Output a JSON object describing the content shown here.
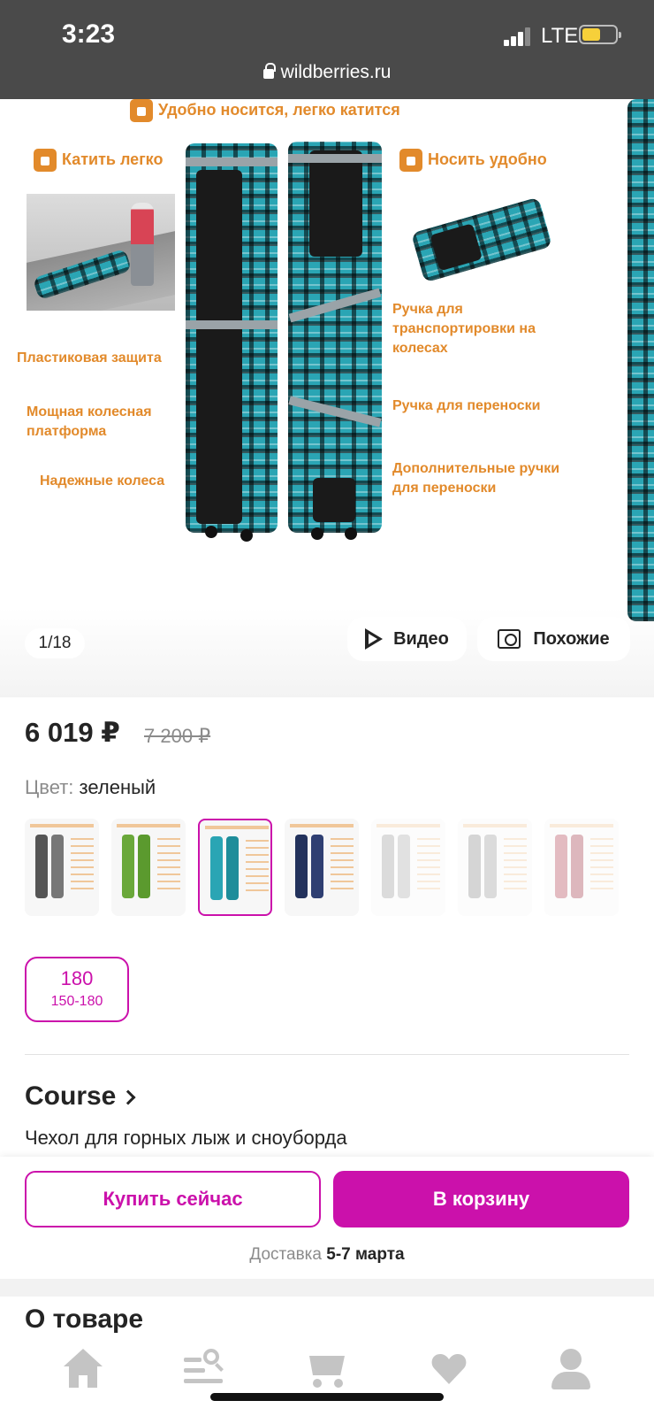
{
  "status_bar": {
    "time": "3:23",
    "network": "LTE"
  },
  "browser": {
    "url": "wildberries.ru"
  },
  "gallery": {
    "counter": "1/18",
    "video_label": "Видео",
    "similar_label": "Похожие",
    "image_text": {
      "top": "Удобно носится, легко катится",
      "roll": "Катить легко",
      "carry": "Носить удобно",
      "handle_wheels": "Ручка для транспортировки на колесах",
      "plastic": "Пластиковая защита",
      "platform": "Мощная колесная платформа",
      "carry_handle": "Ручка для переноски",
      "wheels": "Надежные колеса",
      "extra_handles": "Дополнительные ручки для переноски"
    }
  },
  "product": {
    "price": "6 019 ₽",
    "old_price": "7 200 ₽",
    "color_label": "Цвет:",
    "color_value": "зеленый",
    "size_main": "180",
    "size_sub": "150-180",
    "brand": "Course",
    "name": "Чехол для горных лыж и сноуборда"
  },
  "actions": {
    "buy_now": "Купить сейчас",
    "add_to_cart": "В корзину",
    "delivery_label": "Доставка",
    "delivery_value": "5-7 марта"
  },
  "section_about": "О товаре",
  "colors": {
    "accent": "#cb11ab",
    "promo_orange": "#e28a2b",
    "icon_gray": "#c4c4c4"
  },
  "tabbar": {
    "icons": [
      "home-icon",
      "catalog-search-icon",
      "cart-icon",
      "heart-icon",
      "profile-icon"
    ]
  }
}
